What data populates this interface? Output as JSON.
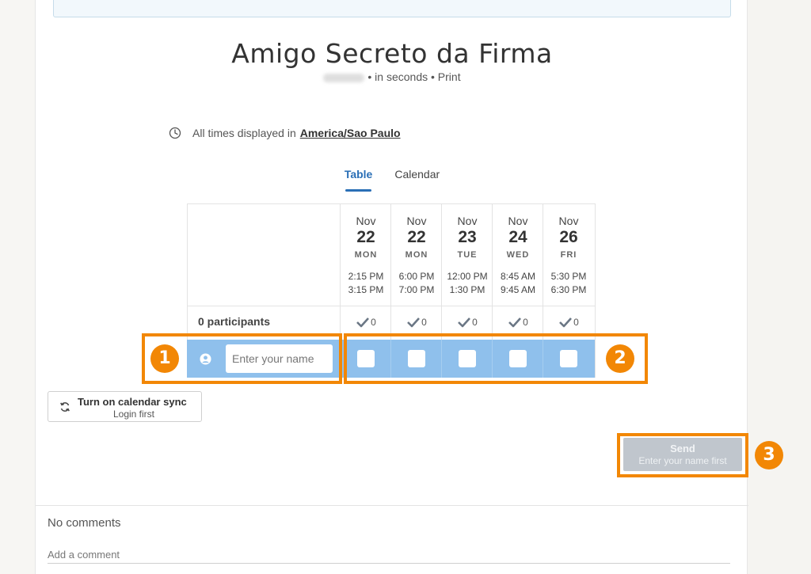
{
  "poll": {
    "title": "Amigo Secreto da Firma",
    "subtitle_rest": "• in seconds • Print"
  },
  "timezone": {
    "prefix": "All times displayed in",
    "zone": "America/Sao Paulo"
  },
  "tabs": [
    {
      "label": "Table",
      "active": true
    },
    {
      "label": "Calendar",
      "active": false
    }
  ],
  "options": [
    {
      "month": "Nov",
      "day": "22",
      "weekday": "MON",
      "start": "2:15 PM",
      "end": "3:15 PM",
      "count": "0"
    },
    {
      "month": "Nov",
      "day": "22",
      "weekday": "MON",
      "start": "6:00 PM",
      "end": "7:00 PM",
      "count": "0"
    },
    {
      "month": "Nov",
      "day": "23",
      "weekday": "TUE",
      "start": "12:00 PM",
      "end": "1:30 PM",
      "count": "0"
    },
    {
      "month": "Nov",
      "day": "24",
      "weekday": "WED",
      "start": "8:45 AM",
      "end": "9:45 AM",
      "count": "0"
    },
    {
      "month": "Nov",
      "day": "26",
      "weekday": "FRI",
      "start": "5:30 PM",
      "end": "6:30 PM",
      "count": "0"
    }
  ],
  "participants_label": "0 participants",
  "name_input": {
    "placeholder": "Enter your name",
    "value": ""
  },
  "sync": {
    "label": "Turn on calendar sync",
    "sublabel": "Login first"
  },
  "send": {
    "label": "Send",
    "sublabel": "Enter your name first"
  },
  "comments": {
    "header": "No comments",
    "placeholder": "Add a comment"
  },
  "annotations": [
    "1",
    "2",
    "3"
  ],
  "colors": {
    "accent": "#2a6fb6",
    "row_highlight": "#8fc0ec",
    "annotation": "#f28705",
    "send_disabled": "#c0c6cd"
  }
}
